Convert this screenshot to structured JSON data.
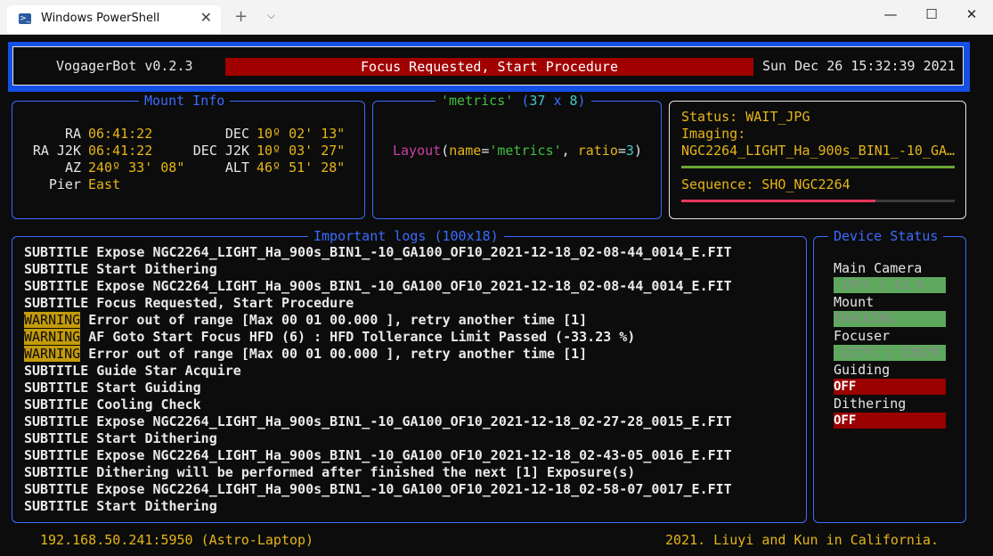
{
  "window": {
    "tab_title": "Windows PowerShell",
    "tab_icon": "powershell-icon",
    "close_tab": "✕",
    "new_tab": "+",
    "dropdown": "⌵",
    "minimize": "—",
    "maximize": "☐",
    "close": "✕"
  },
  "header": {
    "app": "VogagerBot v0.2.3",
    "status": "Focus Requested, Start Procedure",
    "datetime": "Sun Dec 26 15:32:39 2021"
  },
  "mount": {
    "title": "Mount Info",
    "ra_label": "RA",
    "ra": "06:41:22",
    "dec_label": "DEC",
    "dec": "10º 02' 13\"",
    "raj2k_label": "RA J2K",
    "raj2k": "06:41:22",
    "decj2k_label": "DEC J2K",
    "decj2k": "10º 03' 27\"",
    "az_label": "AZ",
    "az": "240º 33' 08\"",
    "alt_label": "ALT",
    "alt": "46º 51' 28\"",
    "pier_label": "Pier",
    "pier": "East"
  },
  "metrics": {
    "title_name": "'metrics'",
    "title_open": "(",
    "title_w": "37",
    "title_x": "x",
    "title_h": "8",
    "title_close": ")",
    "layout_fn": "Layout",
    "layout_p1": "(",
    "layout_name_key": "name",
    "layout_eq1": "=",
    "layout_name_val": "'metrics'",
    "layout_comma": ", ",
    "layout_ratio_key": "ratio",
    "layout_eq2": "=",
    "layout_ratio_val": "3",
    "layout_p2": ")"
  },
  "status": {
    "status_line": "Status: WAIT_JPG",
    "imaging_label": "Imaging:",
    "imaging_file": "NGC2264_LIGHT_Ha_900s_BIN1_-10_GA…",
    "sequence": "Sequence: SHO_NGC2264",
    "imaging_progress": 1.0,
    "sequence_progress": 0.71
  },
  "logs": {
    "title": "Important logs (100x18)",
    "lines": [
      {
        "tag": "SUBTITLE",
        "msg": "Expose NGC2264_LIGHT_Ha_900s_BIN1_-10_GA100_OF10_2021-12-18_02-08-44_0014_E.FIT"
      },
      {
        "tag": "SUBTITLE",
        "msg": "Start Dithering"
      },
      {
        "tag": "SUBTITLE",
        "msg": "Expose NGC2264_LIGHT_Ha_900s_BIN1_-10_GA100_OF10_2021-12-18_02-08-44_0014_E.FIT"
      },
      {
        "tag": "SUBTITLE",
        "msg": "Focus Requested, Start Procedure"
      },
      {
        "tag": "WARNING",
        "msg": "Error out of range [Max 00 01 00.000 ], retry another time [1]"
      },
      {
        "tag": "WARNING",
        "msg": "AF Goto Start Focus HFD (6) : HFD Tollerance Limit Passed (-33.23 %)"
      },
      {
        "tag": "WARNING",
        "msg": "Error out of range [Max 00 01 00.000 ], retry another time [1]"
      },
      {
        "tag": "SUBTITLE",
        "msg": "Guide Star Acquire"
      },
      {
        "tag": "SUBTITLE",
        "msg": "Start Guiding"
      },
      {
        "tag": "SUBTITLE",
        "msg": "Cooling Check"
      },
      {
        "tag": "SUBTITLE",
        "msg": "Expose NGC2264_LIGHT_Ha_900s_BIN1_-10_GA100_OF10_2021-12-18_02-27-28_0015_E.FIT"
      },
      {
        "tag": "SUBTITLE",
        "msg": "Start Dithering"
      },
      {
        "tag": "SUBTITLE",
        "msg": "Expose NGC2264_LIGHT_Ha_900s_BIN1_-10_GA100_OF10_2021-12-18_02-43-05_0016_E.FIT"
      },
      {
        "tag": "SUBTITLE",
        "msg": "Dithering will be performed after finished the next [1] Exposure(s)"
      },
      {
        "tag": "SUBTITLE",
        "msg": "Expose NGC2264_LIGHT_Ha_900s_BIN1_-10_GA100_OF10_2021-12-18_02-58-07_0017_E.FIT"
      },
      {
        "tag": "SUBTITLE",
        "msg": "Start Dithering"
      }
    ]
  },
  "devices": {
    "title": "Device Status",
    "items": [
      {
        "label": "Main Camera",
        "value": "-10ºC | 11 %",
        "ok": true
      },
      {
        "label": "Mount",
        "value": "TRACKING",
        "ok": true
      },
      {
        "label": "Focuser",
        "value": "-127ºC | 13870",
        "ok": true
      },
      {
        "label": "Guiding",
        "value": "OFF",
        "ok": false
      },
      {
        "label": "Dithering",
        "value": "OFF",
        "ok": false
      }
    ]
  },
  "footer": {
    "left": "192.168.50.241:5950 (Astro-Laptop)",
    "right": "2021. Liuyi and Kun in California."
  },
  "colors": {
    "accent_blue": "#1450e6",
    "panel_blue": "#3a6cff",
    "yellow": "#e5b517",
    "ok_green": "#5ea85e",
    "ok_text": "#8fc98f",
    "bad_red": "#9a0000",
    "warning_bg": "#c49b0a"
  }
}
